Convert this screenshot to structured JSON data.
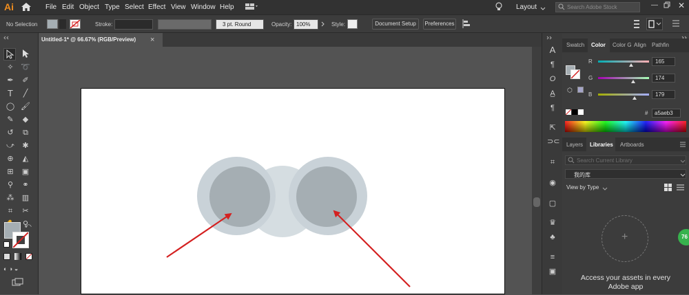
{
  "app": {
    "logo": "Ai",
    "menus": [
      "File",
      "Edit",
      "Object",
      "Type",
      "Select",
      "Effect",
      "View",
      "Window",
      "Help"
    ],
    "workspace_label": "Layout",
    "search_placeholder": "Search Adobe Stock"
  },
  "control_bar": {
    "selection_label": "No Selection",
    "stroke_label": "Stroke:",
    "brush_value": "3 pt. Round",
    "opacity_label": "Opacity:",
    "opacity_value": "100%",
    "style_label": "Style:",
    "document_setup_label": "Document Setup",
    "preferences_label": "Preferences"
  },
  "document": {
    "tab_title": "Untitled-1* @ 66.67% (RGB/Preview)",
    "close_glyph": "×"
  },
  "color_panel": {
    "tabs": [
      "Swatch",
      "Color",
      "Color G",
      "Align",
      "Pathfin"
    ],
    "active_tab": "Color",
    "channels": [
      {
        "label": "R",
        "value": "165",
        "fraction": 0.647
      },
      {
        "label": "G",
        "value": "174",
        "fraction": 0.682
      },
      {
        "label": "B",
        "value": "179",
        "fraction": 0.702
      }
    ],
    "hex_label": "#",
    "hex_value": "a5aeb3",
    "current_fill": "#a5aeb3"
  },
  "libraries_panel": {
    "tabs": [
      "Layers",
      "Libraries",
      "Artboards"
    ],
    "active_tab": "Libraries",
    "search_placeholder": "Search Current Library",
    "library_name": "我的库",
    "view_by_label": "View by Type",
    "add_glyph": "+",
    "empty_message_line1": "Access your assets in every",
    "empty_message_line2": "Adobe app"
  },
  "badge": {
    "text": "76"
  },
  "colors": {
    "accent": "#e8e8e8",
    "shape_outer": "#c9d2d8",
    "shape_middle": "#d5dde1",
    "shape_inner": "#a5aeb3",
    "arrow": "#d42121"
  }
}
